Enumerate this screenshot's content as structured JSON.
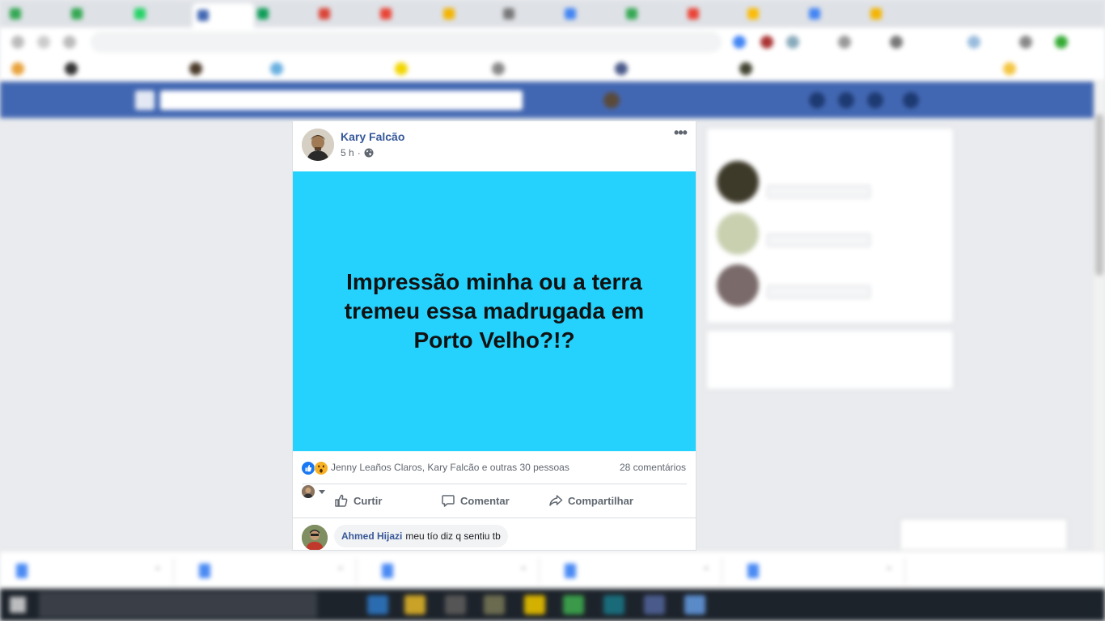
{
  "post": {
    "author": "Kary Falcão",
    "time": "5 h",
    "separator": "·",
    "privacy_icon": "globe-icon",
    "text": "Impressão minha ou a terra tremeu essa madrugada em Porto Velho?!?",
    "background_color": "#25d2fd",
    "reactions": {
      "icons": [
        "like-icon",
        "wow-icon"
      ],
      "text": "Jenny Leaños Claros, Kary Falcão e outras 30 pessoas"
    },
    "comments_count": "28 comentários",
    "actions": {
      "like": "Curtir",
      "comment": "Comentar",
      "share": "Compartilhar"
    },
    "comment": {
      "author": "Ahmed Hijazi",
      "text": "meu tío diz q sentiu tb"
    }
  },
  "colors": {
    "facebook_blue": "#4267b2",
    "link_blue": "#365899",
    "page_bg": "#e9ebee"
  }
}
